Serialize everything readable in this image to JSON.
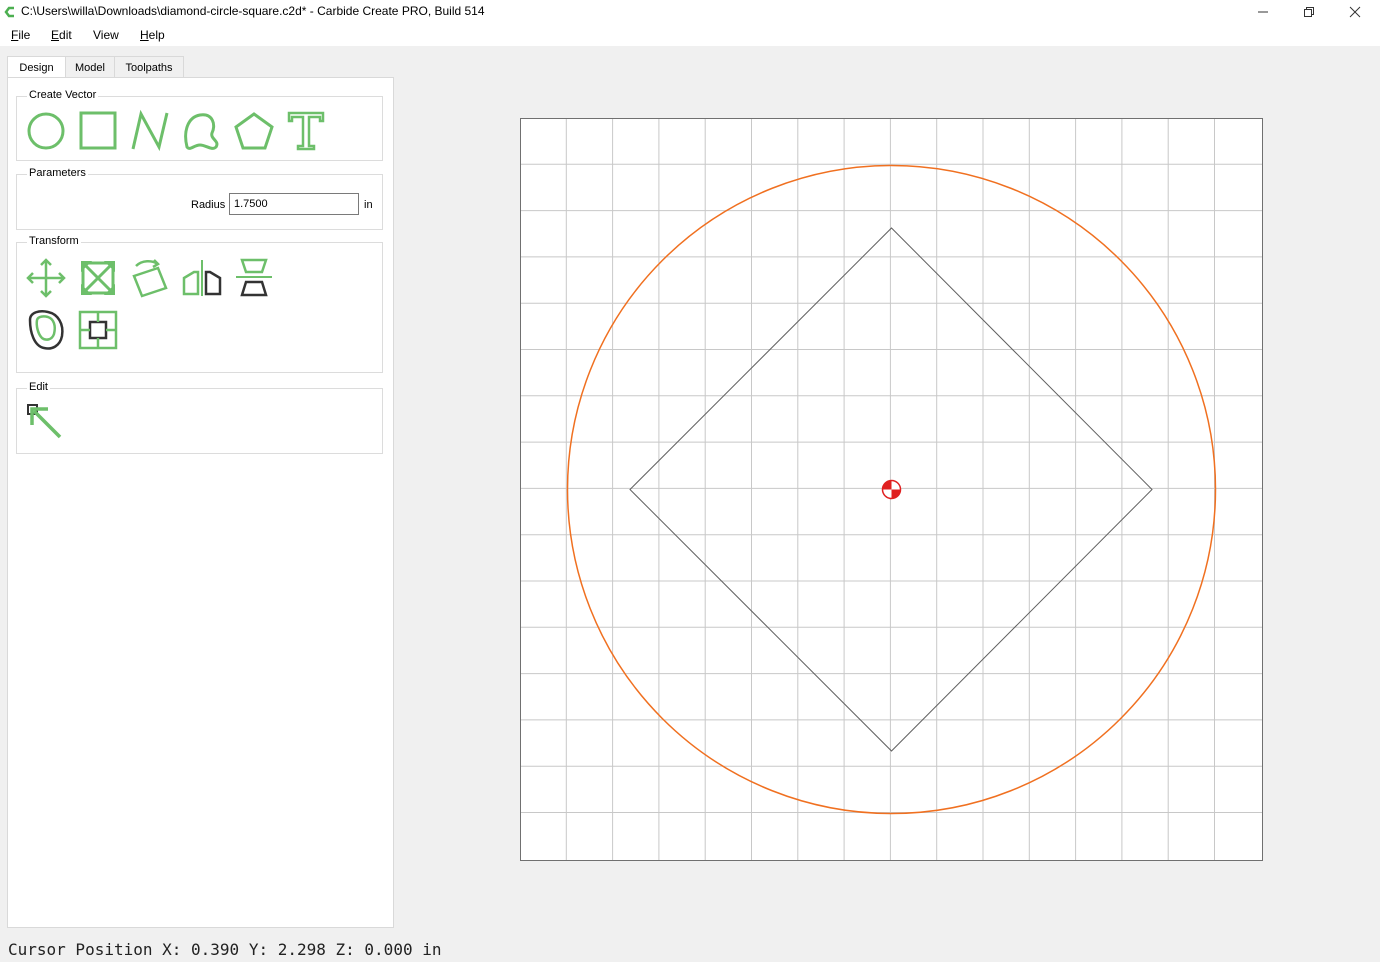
{
  "window": {
    "title": "C:\\Users\\willa\\Downloads\\diamond-circle-square.c2d* - Carbide Create PRO, Build 514",
    "app_icon": "carbide-logo-icon",
    "controls": [
      "minimize-icon",
      "restore-icon",
      "close-icon"
    ]
  },
  "menu": {
    "items": [
      {
        "label": "File",
        "underline": "F",
        "rest": "ile"
      },
      {
        "label": "Edit",
        "underline": "E",
        "rest": "dit"
      },
      {
        "label": "View",
        "underline": "",
        "rest": "View"
      },
      {
        "label": "Help",
        "underline": "H",
        "rest": "elp"
      }
    ]
  },
  "tabs": [
    {
      "label": "Design",
      "active": true
    },
    {
      "label": "Model",
      "active": false
    },
    {
      "label": "Toolpaths",
      "active": false
    }
  ],
  "create_vector": {
    "title": "Create Vector",
    "tools": [
      "circle-icon",
      "rectangle-icon",
      "polyline-icon",
      "curve-icon",
      "polygon-icon",
      "text-icon"
    ]
  },
  "parameters": {
    "title": "Parameters",
    "radius_label": "Radius",
    "radius_value": "1.7500",
    "unit": "in"
  },
  "transform": {
    "title": "Transform",
    "tools": [
      "move-icon",
      "scale-icon",
      "rotate-icon",
      "mirror-icon",
      "align-icon",
      "offset-icon",
      "boolean-icon"
    ]
  },
  "edit": {
    "title": "Edit",
    "tools": [
      "node-edit-icon"
    ]
  },
  "colors": {
    "accent_green": "#6dbf6a",
    "circle_orange": "#f07020",
    "grid_line": "#c8c8c8",
    "origin_red": "#e02020"
  },
  "status": {
    "text": "Cursor Position X: 0.390 Y: 2.298 Z: 0.000 in"
  }
}
